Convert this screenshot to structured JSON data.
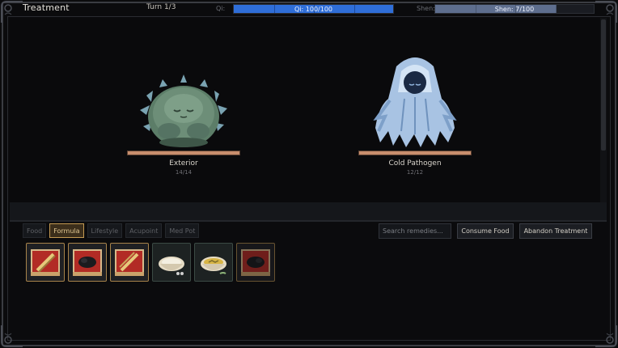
{
  "header": {
    "title": "Treatment",
    "turn": "Turn 1/3",
    "qi_label": "Qi:",
    "qi_text": "Qi: 100/100",
    "qi_fraction": 1.0,
    "shen_label": "Shen:",
    "shen_text": "Shen: 7/100",
    "shen_fraction": 0.76
  },
  "enemies": [
    {
      "name": "Exterior",
      "hp": "14/14",
      "sprite": "green-leafy-blob",
      "hp_fraction": 1.0
    },
    {
      "name": "Cold Pathogen",
      "hp": "12/12",
      "sprite": "ice-ghost",
      "hp_fraction": 1.0
    }
  ],
  "tabs": [
    {
      "label": "Food",
      "active": false
    },
    {
      "label": "Formula",
      "active": true
    },
    {
      "label": "Lifestyle",
      "active": false
    },
    {
      "label": "Acupoint",
      "active": false
    },
    {
      "label": "Med Pot",
      "active": false
    }
  ],
  "search": {
    "placeholder": "Search remedies..."
  },
  "buttons": {
    "consume": "Consume Food",
    "abandon": "Abandon Treatment"
  },
  "cards": [
    {
      "type": "formula",
      "icon": "herb-sticks-icon"
    },
    {
      "type": "formula",
      "icon": "black-herb-icon"
    },
    {
      "type": "formula",
      "icon": "herb-sticks-icon"
    },
    {
      "type": "food",
      "icon": "rice-bowl-icon"
    },
    {
      "type": "food",
      "icon": "soup-bowl-icon"
    },
    {
      "type": "formula",
      "icon": "black-herb-icon",
      "dim": true
    }
  ],
  "colors": {
    "qi": "#2f6ed8",
    "shen": "#5e6e8e",
    "hp": "#c88e6d",
    "active_tab": "#c39a52"
  }
}
